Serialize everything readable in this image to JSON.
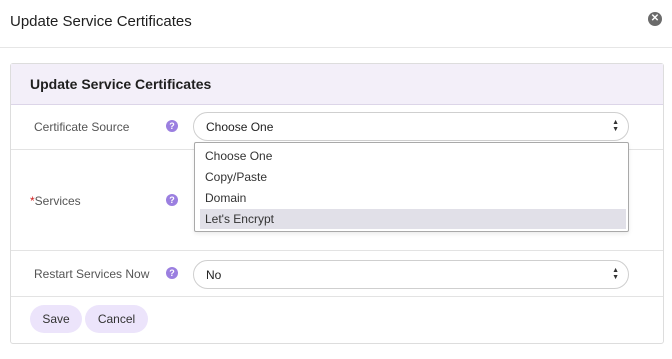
{
  "modal": {
    "title": "Update Service Certificates",
    "close_glyph": "✕"
  },
  "panel": {
    "title": "Update Service Certificates"
  },
  "form": {
    "certificate_source": {
      "label": "Certificate Source",
      "help": "?",
      "value": "Choose One",
      "options": [
        "Choose One",
        "Copy/Paste",
        "Domain",
        "Let's Encrypt"
      ],
      "highlighted_option": "Let's Encrypt"
    },
    "services": {
      "required_mark": "*",
      "label": "Services",
      "help": "?"
    },
    "restart_services_now": {
      "label": "Restart Services Now",
      "help": "?",
      "value": "No"
    }
  },
  "buttons": {
    "save": "Save",
    "cancel": "Cancel"
  },
  "colors": {
    "accent": "#9b7fe0",
    "panel_header_bg": "#f3eff9",
    "button_bg": "#ece4fb",
    "highlight_bg": "#e1e0e8"
  },
  "icons": {
    "close": "close-icon",
    "help": "question-icon",
    "select_arrows": "up-down-arrows-icon"
  }
}
